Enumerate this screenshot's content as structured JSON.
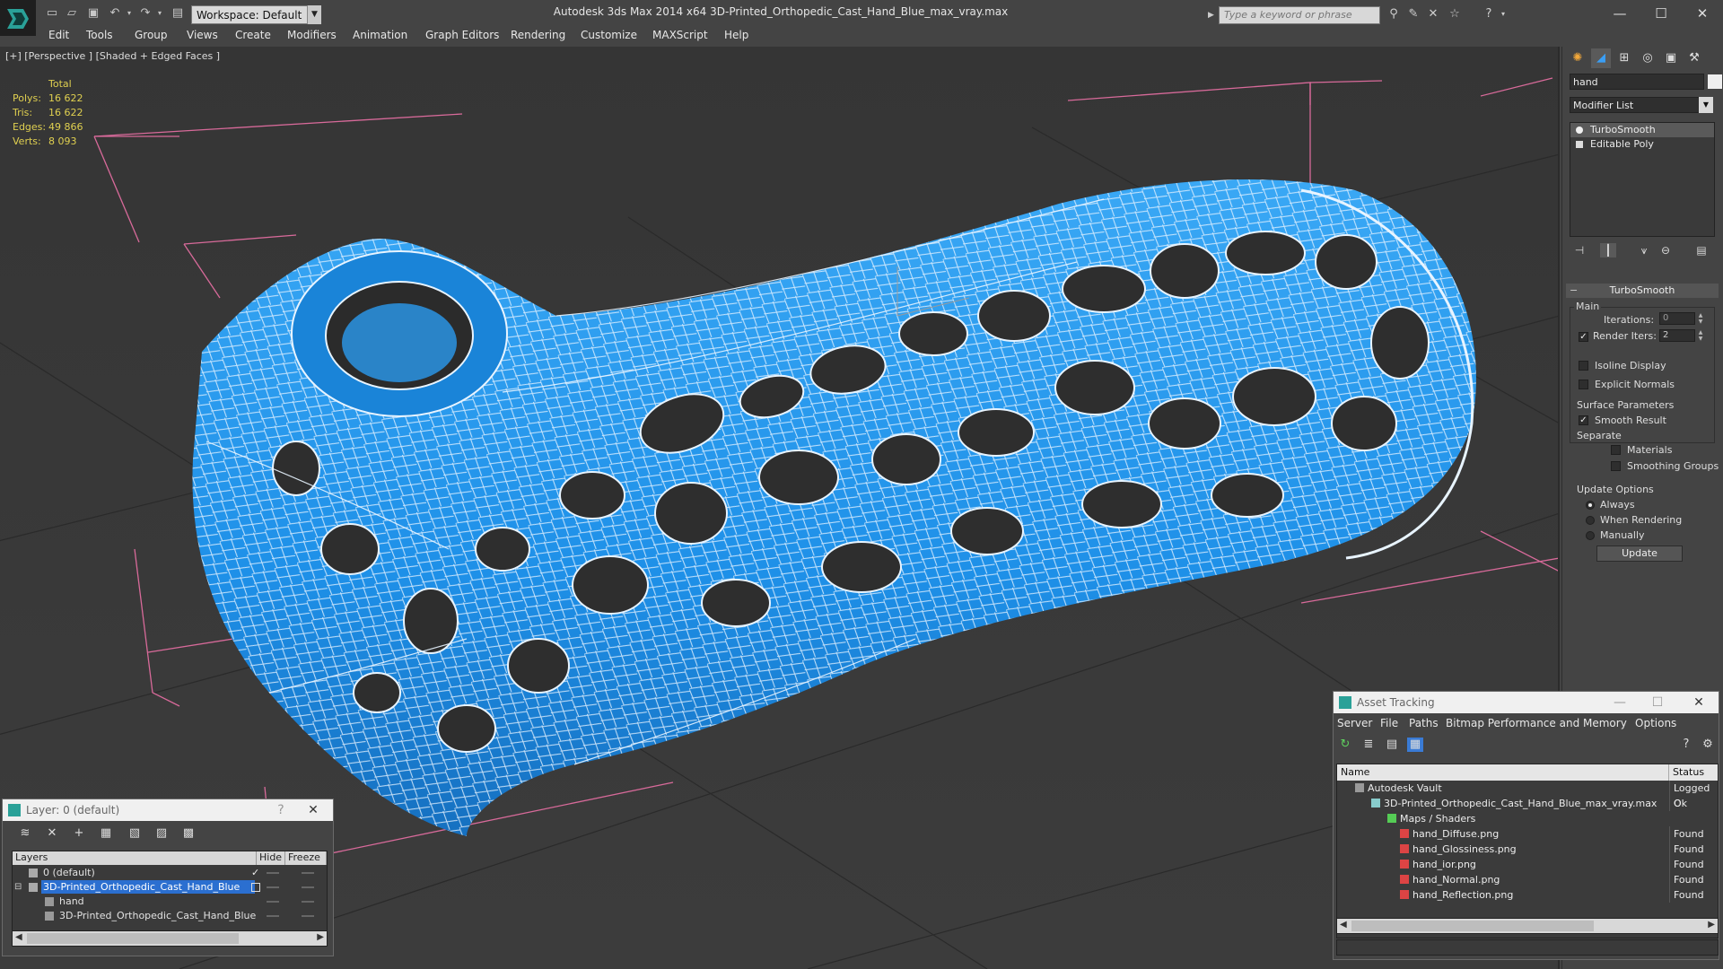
{
  "app": {
    "window_title": "Autodesk 3ds Max  2014 x64      3D-Printed_Orthopedic_Cast_Hand_Blue_max_vray.max",
    "workspace_label": "Workspace: Default",
    "search_placeholder": "Type a keyword or phrase"
  },
  "menu": [
    "Edit",
    "Tools",
    "Group",
    "Views",
    "Create",
    "Modifiers",
    "Animation",
    "Graph Editors",
    "Rendering",
    "Customize",
    "MAXScript",
    "Help"
  ],
  "viewport": {
    "label": "[+] [Perspective ] [Shaded + Edged Faces ]",
    "stats_header": "Total",
    "stats": [
      {
        "label": "Polys:",
        "value": "16 622"
      },
      {
        "label": "Tris:",
        "value": "16 622"
      },
      {
        "label": "Edges:",
        "value": "49 866"
      },
      {
        "label": "Verts:",
        "value": "8 093"
      }
    ],
    "model_color": "#1e90e8"
  },
  "command_panel": {
    "object_name": "hand",
    "modifier_list_label": "Modifier List",
    "stack": [
      "TurboSmooth",
      "Editable Poly"
    ],
    "rollout_title": "TurboSmooth",
    "main_group": "Main",
    "iterations_label": "Iterations:",
    "iterations_value": "0",
    "render_iters_label": "Render Iters:",
    "render_iters_value": "2",
    "isoline_label": "Isoline Display",
    "explicit_normals_label": "Explicit Normals",
    "surface_group": "Surface Parameters",
    "smooth_result_label": "Smooth Result",
    "separate_label": "Separate",
    "materials_label": "Materials",
    "smoothing_groups_label": "Smoothing Groups",
    "update_group": "Update Options",
    "update_always": "Always",
    "update_when_rendering": "When Rendering",
    "update_manually": "Manually",
    "update_button": "Update"
  },
  "layer_dialog": {
    "title": "Layer: 0 (default)",
    "help": "?",
    "columns": [
      "Layers",
      "Hide",
      "Freeze"
    ],
    "rows": [
      {
        "name": "0 (default)",
        "indent": 0,
        "selected": false
      },
      {
        "name": "3D-Printed_Orthopedic_Cast_Hand_Blue",
        "indent": 0,
        "selected": true
      },
      {
        "name": "hand",
        "indent": 1,
        "selected": false
      },
      {
        "name": "3D-Printed_Orthopedic_Cast_Hand_Blue",
        "indent": 1,
        "selected": false
      }
    ]
  },
  "asset_dialog": {
    "title": "Asset Tracking",
    "menu": [
      "Server",
      "File",
      "Paths",
      "Bitmap Performance and Memory",
      "Options"
    ],
    "columns": [
      "Name",
      "Status"
    ],
    "rows": [
      {
        "name": "Autodesk Vault",
        "status": "Logged O",
        "indent": 0
      },
      {
        "name": "3D-Printed_Orthopedic_Cast_Hand_Blue_max_vray.max",
        "status": "Ok",
        "indent": 1
      },
      {
        "name": "Maps / Shaders",
        "status": "",
        "indent": 2
      },
      {
        "name": "hand_Diffuse.png",
        "status": "Found",
        "indent": 3
      },
      {
        "name": "hand_Glossiness.png",
        "status": "Found",
        "indent": 3
      },
      {
        "name": "hand_ior.png",
        "status": "Found",
        "indent": 3
      },
      {
        "name": "hand_Normal.png",
        "status": "Found",
        "indent": 3
      },
      {
        "name": "hand_Reflection.png",
        "status": "Found",
        "indent": 3
      }
    ]
  }
}
